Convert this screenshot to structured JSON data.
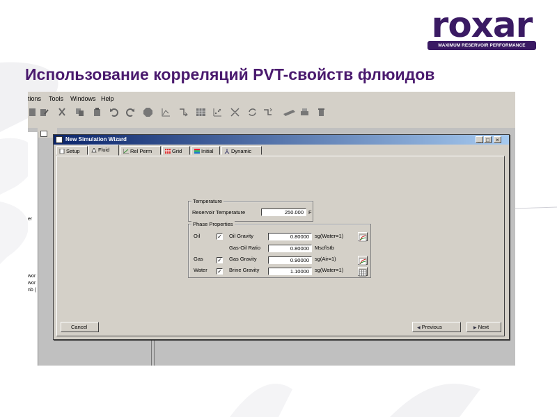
{
  "slide": {
    "title": "Использование корреляций PVT-свойств флюидов",
    "logo_word": "roxar",
    "logo_tagline": "MAXIMUM RESERVOIR PERFORMANCE"
  },
  "app": {
    "menu": [
      "tions",
      "Tools",
      "Windows",
      "Help"
    ],
    "toolbar_icons": [
      "document-icon",
      "edit-icon",
      "cut-icon",
      "copy-icon",
      "paste-icon",
      "undo-icon",
      "redo-icon",
      "stop-icon",
      "chart-icon",
      "import-icon",
      "table-icon",
      "scatter-icon",
      "grid-icon",
      "refresh-icon",
      "export-icon",
      "print-icon",
      "delete-icon"
    ],
    "left_panel_lines": [
      "wor",
      "wor",
      "nb ("
    ],
    "left_tab_label": "er"
  },
  "dialog": {
    "title": "New Simulation Wizard",
    "window_buttons": [
      "_",
      "□",
      "×"
    ],
    "tabs": [
      {
        "label": "Setup",
        "icon": "setup-icon"
      },
      {
        "label": "Fluid",
        "icon": "fluid-icon"
      },
      {
        "label": "Rel Perm",
        "icon": "relperm-icon"
      },
      {
        "label": "Grid",
        "icon": "grid-icon"
      },
      {
        "label": "Initial",
        "icon": "initial-icon"
      },
      {
        "label": "Dynamic",
        "icon": "dynamic-icon"
      }
    ],
    "active_tab": "Fluid",
    "temperature": {
      "group_title": "Temperature",
      "label": "Reservoir Temperature",
      "value": "250.000",
      "unit": "F"
    },
    "phase": {
      "group_title": "Phase Properties",
      "rows": [
        {
          "phase": "Oil",
          "checked": true,
          "property": "Oil Gravity",
          "value": "0.80000",
          "unit": "sg(Water=1)",
          "button_icon": "correlation-chart-icon"
        },
        {
          "phase": "",
          "checked": null,
          "property": "Gas-Oil Ratio",
          "value": "0.80000",
          "unit": "Mscf/stb",
          "button_icon": ""
        },
        {
          "phase": "Gas",
          "checked": true,
          "property": "Gas Gravity",
          "value": "0.90000",
          "unit": "sg(Air=1)",
          "button_icon": "correlation-chart-icon"
        },
        {
          "phase": "Water",
          "checked": true,
          "property": "Brine Gravity",
          "value": "1.10000",
          "unit": "sg(Water=1)",
          "button_icon": "table-icon"
        }
      ]
    },
    "check_mark": "✓",
    "buttons": {
      "cancel": "Cancel",
      "previous": "Previous",
      "next": "Next",
      "previous_arrow": "◀",
      "next_arrow": "▶"
    }
  },
  "colors": {
    "title": "#4a1a6e",
    "logo": "#3a1a63",
    "window_face": "#d4d0c8",
    "titlebar_start": "#0a246a",
    "titlebar_end": "#a6caf0"
  }
}
